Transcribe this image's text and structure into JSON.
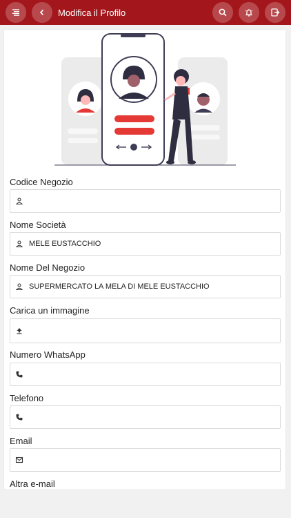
{
  "header": {
    "title": "Modifica il Profilo",
    "icons": {
      "menu": "menu-icon",
      "back": "chevron-left-icon",
      "search": "search-icon",
      "notifications": "bell-icon",
      "logout": "exit-icon"
    },
    "color": "#a3171c"
  },
  "form": {
    "fields": [
      {
        "label": "Codice Negozio",
        "value": "",
        "icon": "person-icon"
      },
      {
        "label": "Nome Società",
        "value": "MELE EUSTACCHIO",
        "icon": "person-icon"
      },
      {
        "label": "Nome Del Negozio",
        "value": "SUPERMERCATO LA MELA DI MELE EUSTACCHIO",
        "icon": "person-icon"
      },
      {
        "label": "Carica un immagine",
        "value": "",
        "icon": "upload-icon"
      },
      {
        "label": "Numero WhatsApp",
        "value": "",
        "icon": "phone-icon"
      },
      {
        "label": "Telefono",
        "value": "",
        "icon": "phone-icon"
      },
      {
        "label": "Email",
        "value": "",
        "icon": "mail-icon"
      },
      {
        "label": "Altra e-mail",
        "value": "",
        "icon": "mail-icon"
      }
    ]
  },
  "illustration": {
    "icon": "profile-illustration",
    "accent_color": "#e53935"
  }
}
